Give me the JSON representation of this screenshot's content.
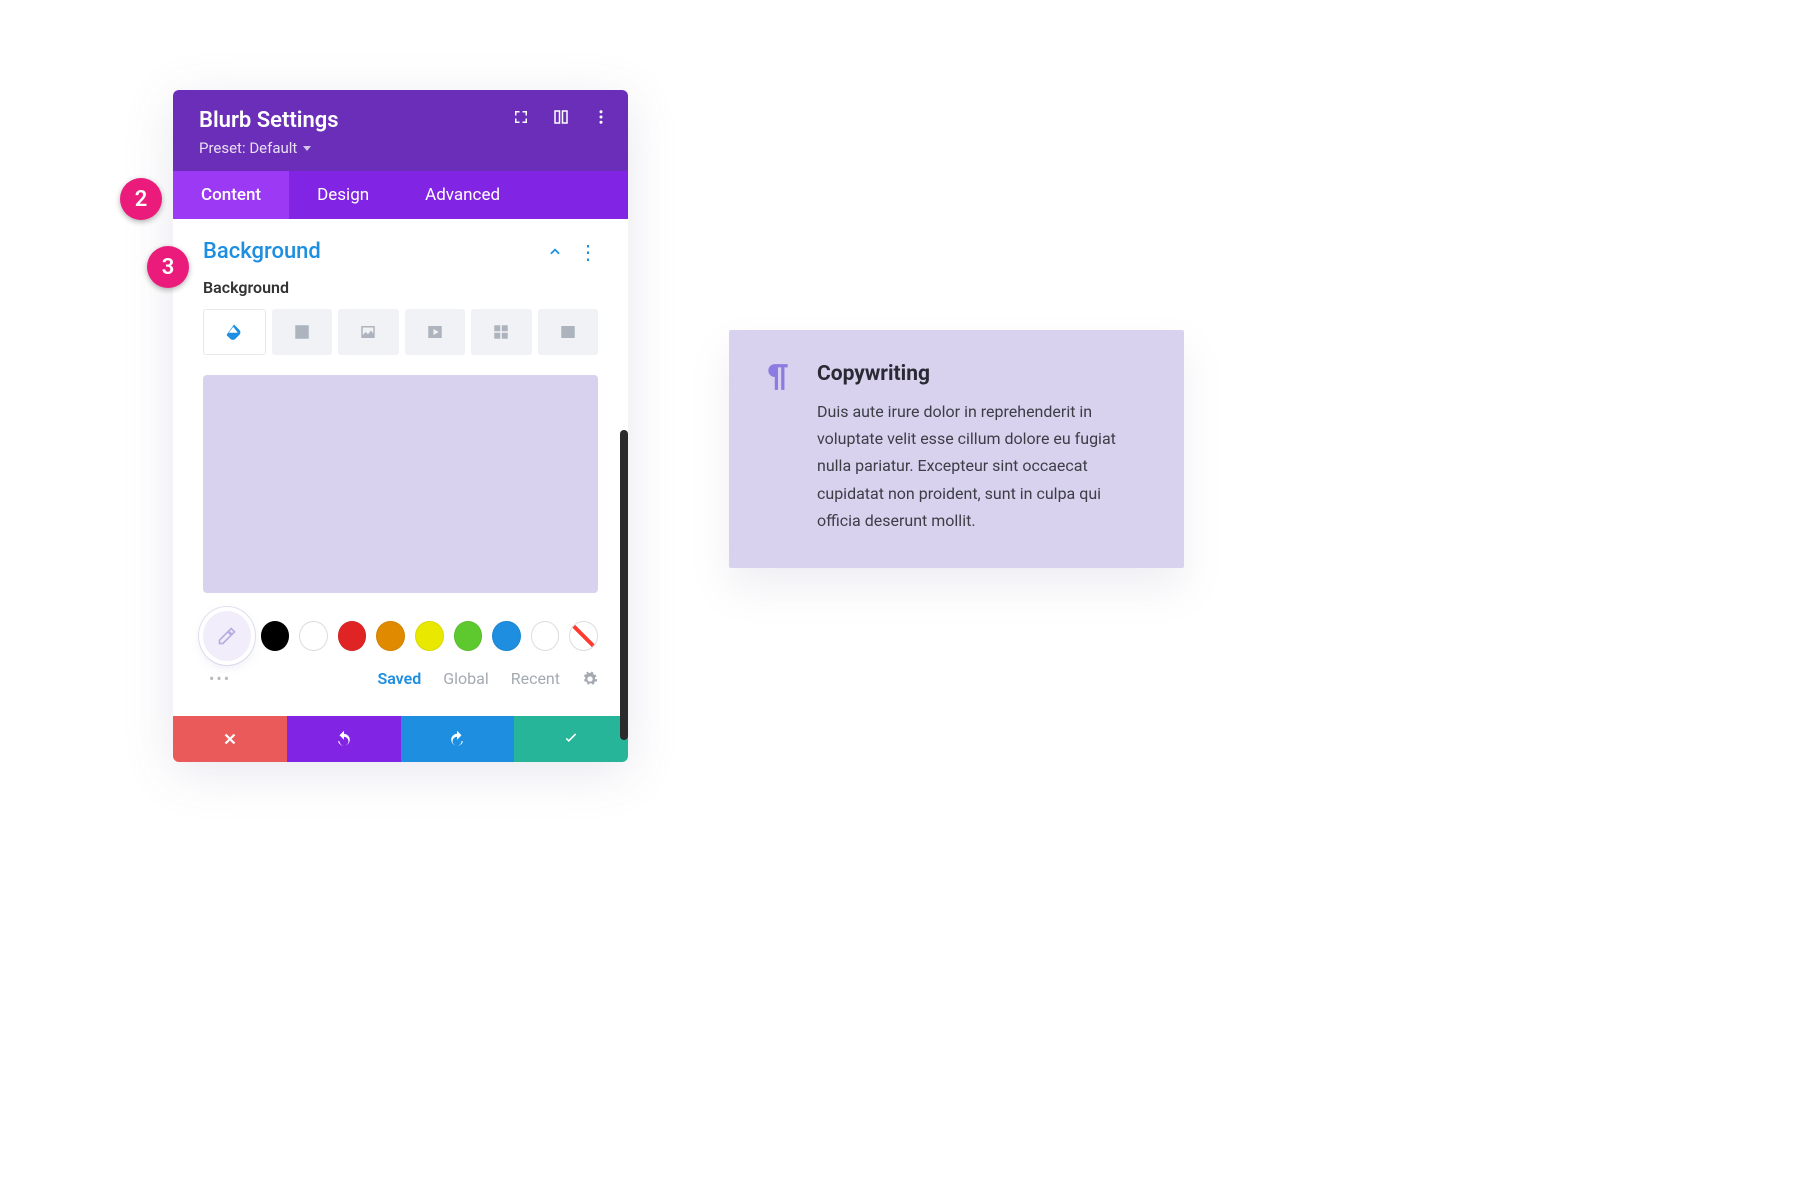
{
  "annotations": {
    "step2": "2",
    "step3": "3"
  },
  "panel": {
    "title": "Blurb Settings",
    "preset_label": "Preset: Default",
    "tabs": {
      "content": "Content",
      "design": "Design",
      "advanced": "Advanced"
    }
  },
  "section": {
    "title": "Background",
    "field_label": "Background",
    "bg_types": [
      "color",
      "gradient",
      "image",
      "video",
      "pattern",
      "mask"
    ],
    "preview_color": "#d8d2ef",
    "swatches": [
      "#000000",
      "#ffffff",
      "#e02424",
      "#e08a00",
      "#e8e800",
      "#5ec92e",
      "#1d8ee0",
      "#ffffff"
    ],
    "palette_tabs": {
      "saved": "Saved",
      "global": "Global",
      "recent": "Recent"
    }
  },
  "card": {
    "title": "Copywriting",
    "text": "Duis aute irure dolor in reprehenderit in voluptate velit esse cillum dolore eu fugiat nulla pariatur. Excepteur sint occaecat cupidatat non proident, sunt in culpa qui officia deserunt mollit."
  }
}
